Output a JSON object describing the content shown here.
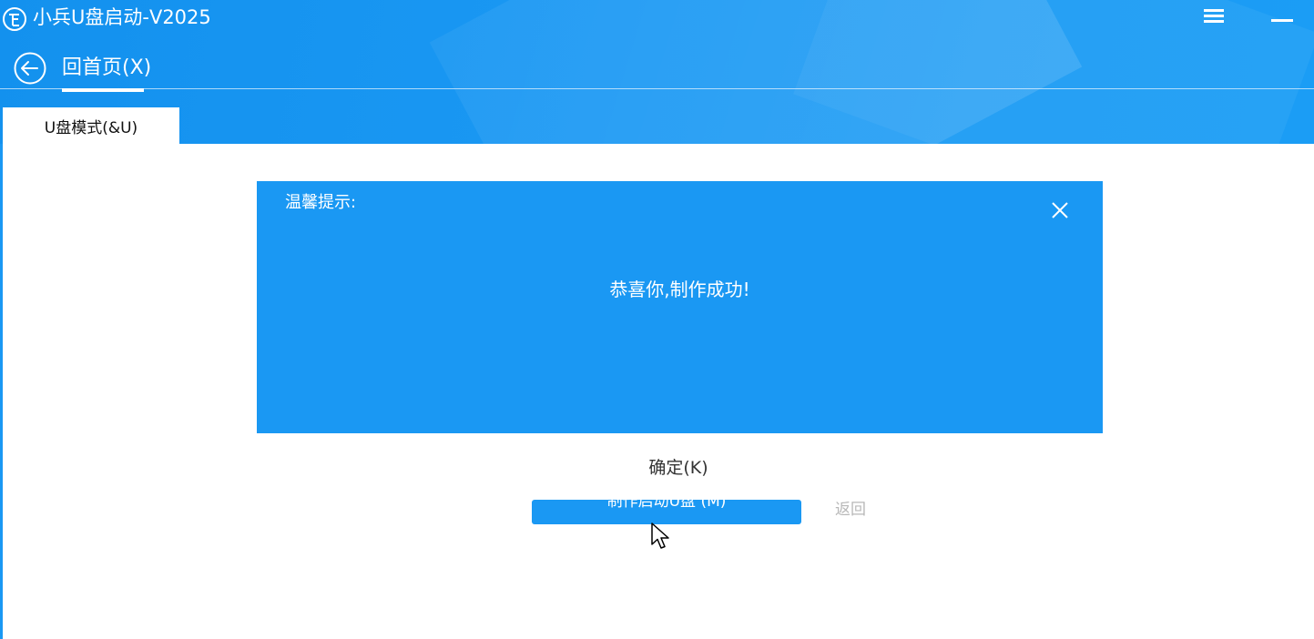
{
  "window": {
    "title": "小兵U盘启动-V2025",
    "logo_text": "Ⓑ"
  },
  "nav": {
    "back_label": "回首页(X)"
  },
  "tabs": [
    {
      "label": "U盘模式(&U)",
      "active": true
    }
  ],
  "main": {
    "make_button_label": "制作启动U盘 (M)",
    "return_label": "返回"
  },
  "dialog": {
    "title": "温馨提示:",
    "message": "恭喜你,制作成功!",
    "confirm_label": "确定(K)"
  },
  "colors": {
    "accent": "#1a98f3",
    "text_dark": "#333333",
    "text_muted": "#b8b8b8"
  },
  "icons": {
    "logo": "app-logo-icon",
    "menu": "hamburger-menu-icon",
    "minimize": "minimize-icon",
    "back": "back-arrow-icon",
    "close": "close-icon",
    "cursor": "mouse-cursor-icon"
  }
}
